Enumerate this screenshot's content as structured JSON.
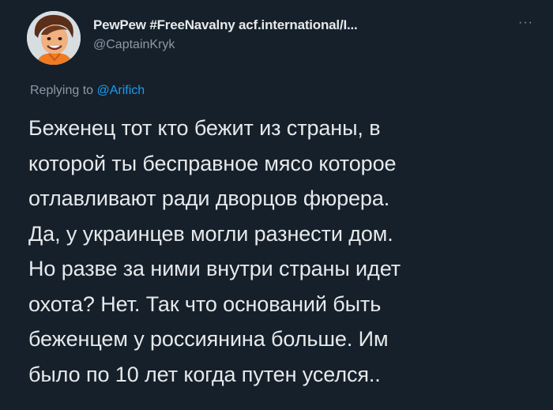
{
  "author": {
    "display_name": "PewPew #FreeNavalny acf.international/I...",
    "handle": "@CaptainKryk",
    "avatar_icon": "cartoon-avatar-icon"
  },
  "more_icon": "more-horizontal-icon",
  "reply": {
    "prefix": "Replying to",
    "mention": "@Arifich"
  },
  "body_lines": [
    "Беженец тот кто бежит из страны, в",
    "которой ты бесправное мясо которое",
    "отлавливают ради дворцов фюрера.",
    "Да, у украинцев могли разнести дом.",
    "Но разве за ними внутри страны идет",
    "охота? Нет. Так что оснований быть",
    "беженцем у россиянина больше. Им",
    "было по 10 лет когда путен уселся.."
  ],
  "colors": {
    "background": "#15202b",
    "text": "#e7e9ea",
    "secondary": "#8b98a5",
    "link": "#1d9bf0"
  }
}
